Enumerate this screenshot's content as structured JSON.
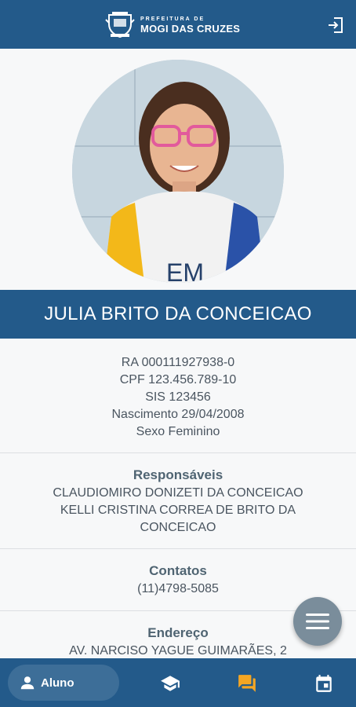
{
  "header": {
    "logo_small": "PREFEITURA DE",
    "logo_big": "MOGI DAS CRUZES",
    "exit_icon": "logout-icon"
  },
  "student": {
    "name": "JULIA BRITO DA CONCEICAO",
    "ra": "RA 000111927938-0",
    "cpf": "CPF 123.456.789-10",
    "sis": "SIS 123456",
    "nascimento": "Nascimento 29/04/2008",
    "sexo": "Sexo Feminino"
  },
  "responsaveis": {
    "title": "Responsáveis",
    "line1": "CLAUDIOMIRO DONIZETI DA CONCEICAO",
    "line2": "KELLI CRISTINA CORREA DE BRITO DA",
    "line3": "CONCEICAO"
  },
  "contatos": {
    "title": "Contatos",
    "phone": "(11)4798-5085"
  },
  "endereco": {
    "title": "Endereço",
    "line1": "AV. NARCISO YAGUE GUIMARÃES, 2"
  },
  "fab": {
    "icon": "menu-icon"
  },
  "bottom_nav": {
    "active_label": "Aluno",
    "items": [
      "person-icon",
      "graduation-cap-icon",
      "chat-icon",
      "calendar-icon"
    ],
    "active_color": "#ffffff",
    "chat_color": "#f5a623"
  },
  "colors": {
    "primary": "#235a8a",
    "fab": "#7a8d9b"
  }
}
